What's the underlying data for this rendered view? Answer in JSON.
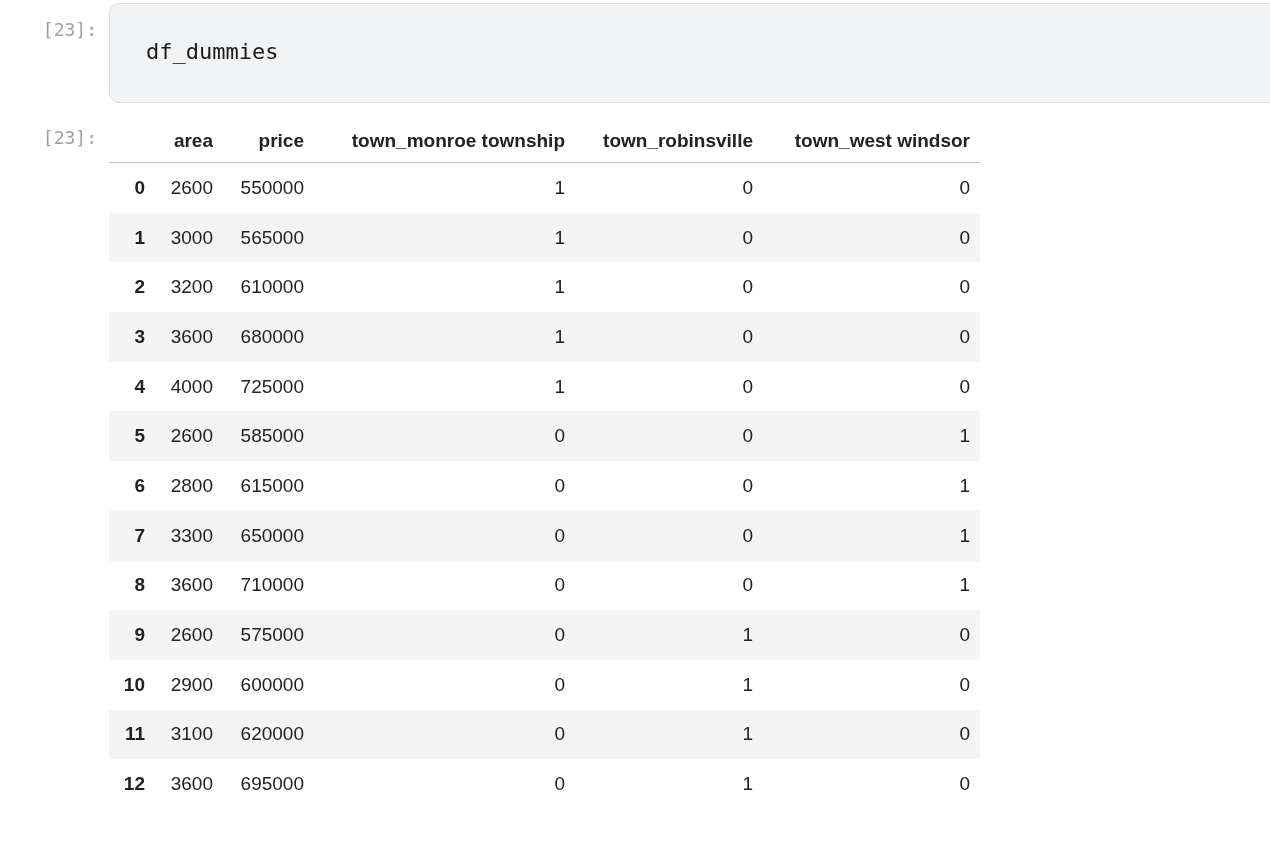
{
  "input_cell": {
    "prompt": "[23]:",
    "code": "df_dummies"
  },
  "output_cell": {
    "prompt": "[23]:",
    "table": {
      "columns": [
        "area",
        "price",
        "town_monroe township",
        "town_robinsville",
        "town_west windsor"
      ],
      "rows": [
        {
          "index": "0",
          "cells": [
            "2600",
            "550000",
            "1",
            "0",
            "0"
          ]
        },
        {
          "index": "1",
          "cells": [
            "3000",
            "565000",
            "1",
            "0",
            "0"
          ]
        },
        {
          "index": "2",
          "cells": [
            "3200",
            "610000",
            "1",
            "0",
            "0"
          ]
        },
        {
          "index": "3",
          "cells": [
            "3600",
            "680000",
            "1",
            "0",
            "0"
          ]
        },
        {
          "index": "4",
          "cells": [
            "4000",
            "725000",
            "1",
            "0",
            "0"
          ]
        },
        {
          "index": "5",
          "cells": [
            "2600",
            "585000",
            "0",
            "0",
            "1"
          ]
        },
        {
          "index": "6",
          "cells": [
            "2800",
            "615000",
            "0",
            "0",
            "1"
          ]
        },
        {
          "index": "7",
          "cells": [
            "3300",
            "650000",
            "0",
            "0",
            "1"
          ]
        },
        {
          "index": "8",
          "cells": [
            "3600",
            "710000",
            "0",
            "0",
            "1"
          ]
        },
        {
          "index": "9",
          "cells": [
            "2600",
            "575000",
            "0",
            "1",
            "0"
          ]
        },
        {
          "index": "10",
          "cells": [
            "2900",
            "600000",
            "0",
            "1",
            "0"
          ]
        },
        {
          "index": "11",
          "cells": [
            "3100",
            "620000",
            "0",
            "1",
            "0"
          ]
        },
        {
          "index": "12",
          "cells": [
            "3600",
            "695000",
            "0",
            "1",
            "0"
          ]
        }
      ]
    }
  }
}
